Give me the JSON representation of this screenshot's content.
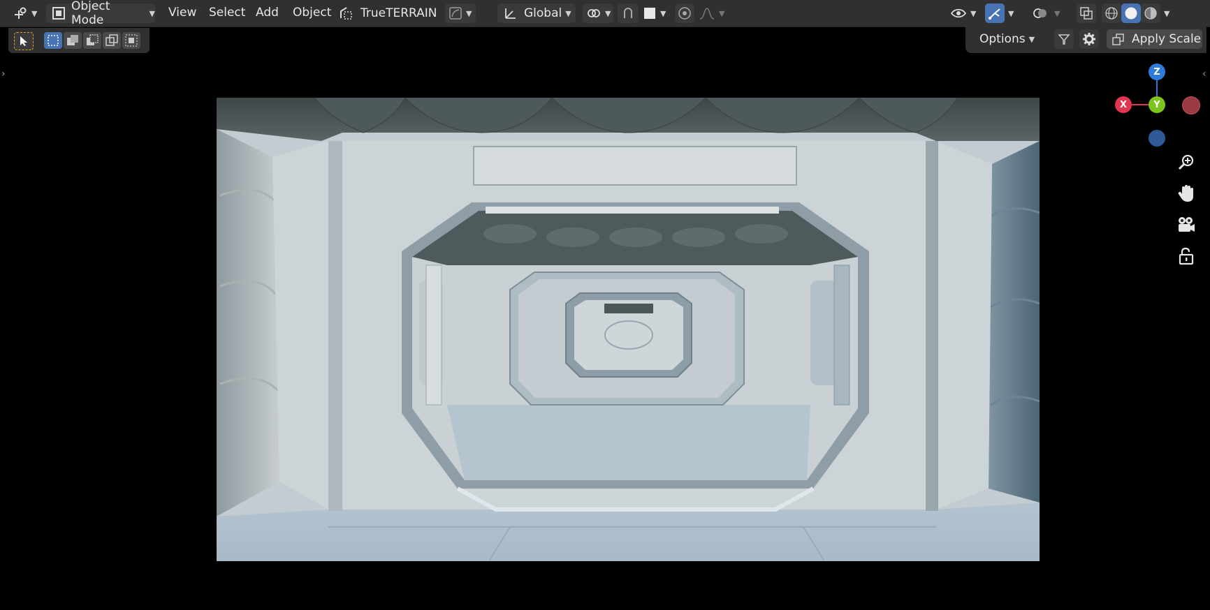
{
  "header": {
    "mode_label": "Object Mode",
    "menus": [
      "View",
      "Select",
      "Add",
      "Object"
    ],
    "addon_label": "TrueTERRAIN",
    "orientation_label": "Global"
  },
  "tool_settings": {
    "options_label": "Options",
    "apply_scale_label": "Apply Scale"
  },
  "gizmo": {
    "z_label": "Z",
    "x_label": "X",
    "y_label": "Y",
    "colors": {
      "x": "#e2354f",
      "y": "#7dc41c",
      "z": "#2f7bd9"
    }
  },
  "icons": {
    "editor_type": "editor-type-icon",
    "mode": "object-mode-icon",
    "addon": "terrain-icon",
    "transform_orientation": "orientation-icon",
    "snap": "snap-icon",
    "proportional": "proportional-edit-icon",
    "visibility": "eye-icon",
    "gizmos": "gizmo-toggle-icon",
    "overlays": "overlays-icon",
    "xray": "xray-icon",
    "shading_wire": "wireframe-shading-icon",
    "shading_solid": "solid-shading-icon",
    "shading_material": "material-shading-icon",
    "zoom": "zoom-icon",
    "pan": "hand-icon",
    "camera": "camera-icon",
    "lock": "lock-icon",
    "filter": "filter-icon",
    "settings": "gear-icon"
  },
  "accent": "#4772b3"
}
